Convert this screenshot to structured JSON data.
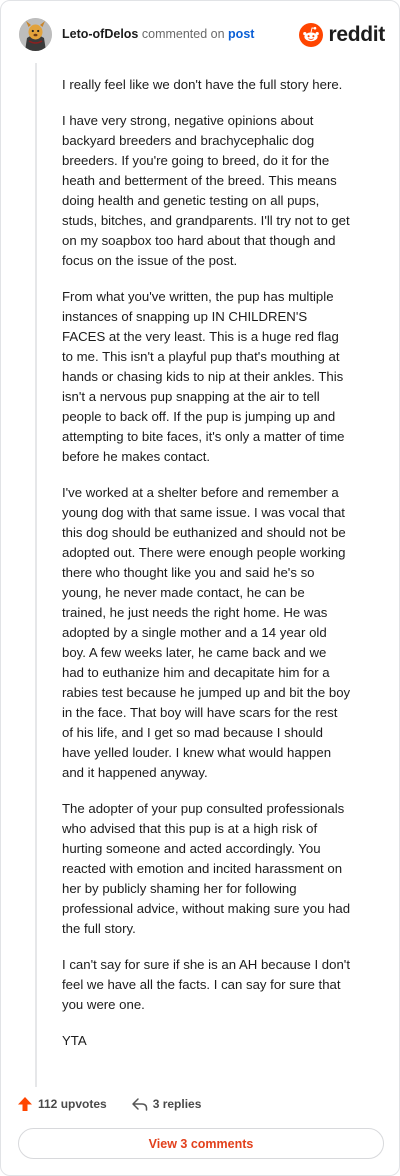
{
  "header": {
    "username": "Leto-ofDelos",
    "verb": "commented on",
    "target": "post",
    "brand": "reddit",
    "avatar_icon": "dog-avatar-icon",
    "brand_color": "#ff4500"
  },
  "comment": {
    "paragraphs": [
      "I really feel like we don't have the full story here.",
      "I have very strong, negative opinions about backyard breeders and brachycephalic dog breeders. If you're going to breed, do it for the heath and betterment of the breed. This means doing health and genetic testing on all pups, studs, bitches, and grandparents. I'll try not to get on my soapbox too hard about that though and focus on the issue of the post.",
      "From what you've written, the pup has multiple instances of snapping up IN CHILDREN'S FACES at the very least. This is a huge red flag to me. This isn't a playful pup that's mouthing at hands or chasing kids to nip at their ankles. This isn't a nervous pup snapping at the air to tell people to back off. If the pup is jumping up and attempting to bite faces, it's only a matter of time before he makes contact.",
      "I've worked at a shelter before and remember a young dog with that same issue. I was vocal that this dog should be euthanized and should not be adopted out. There were enough people working there who thought like you and said he's so young, he never made contact, he can be trained, he just needs the right home. He was adopted by a single mother and a 14 year old boy. A few weeks later, he came back and we had to euthanize him and decapitate him for a rabies test because he jumped up and bit the boy in the face. That boy will have scars for the rest of his life, and I get so mad because I should have yelled louder. I knew what would happen and it happened anyway.",
      "The adopter of your pup consulted professionals who advised that this pup is at a high risk of hurting someone and acted accordingly. You reacted with emotion and incited harassment on her by publicly shaming her for following professional advice, without making sure you had the full story.",
      "I can't say for sure if she is an AH because I don't feel we have all the facts. I can say for sure that you were one.",
      "YTA"
    ]
  },
  "actions": {
    "upvotes": "112 upvotes",
    "replies": "3 replies",
    "upvote_color": "#ff4500",
    "upvote_icon": "upvote-arrow-icon",
    "reply_icon": "reply-arrow-icon"
  },
  "footer": {
    "view_comments": "View 3 comments",
    "button_text_color": "#e2401c"
  }
}
